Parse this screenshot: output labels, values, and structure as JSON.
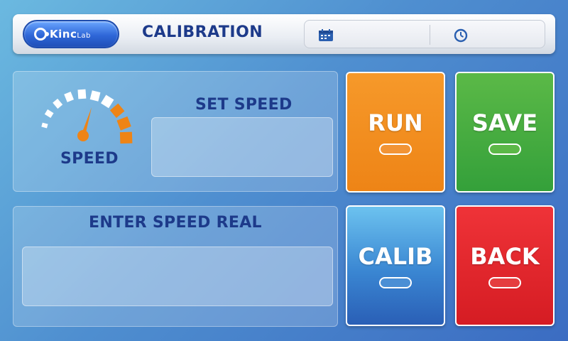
{
  "header": {
    "logo_text": "Kinc",
    "logo_suffix": "Lab",
    "title": "CALIBRATION",
    "date_icon": "calendar-icon",
    "time_icon": "clock-icon"
  },
  "speed_panel": {
    "gauge_label": "SPEED",
    "set_speed_label": "SET SPEED",
    "set_speed_value": ""
  },
  "real_panel": {
    "label": "ENTER SPEED REAL",
    "value": ""
  },
  "buttons": {
    "run": "RUN",
    "save": "SAVE",
    "calib": "CALIB",
    "back": "BACK"
  },
  "colors": {
    "run": "#f39a2a",
    "save": "#45ad3e",
    "calib": "#3f8ad4",
    "back": "#e2252b",
    "title": "#1d3a8a"
  }
}
